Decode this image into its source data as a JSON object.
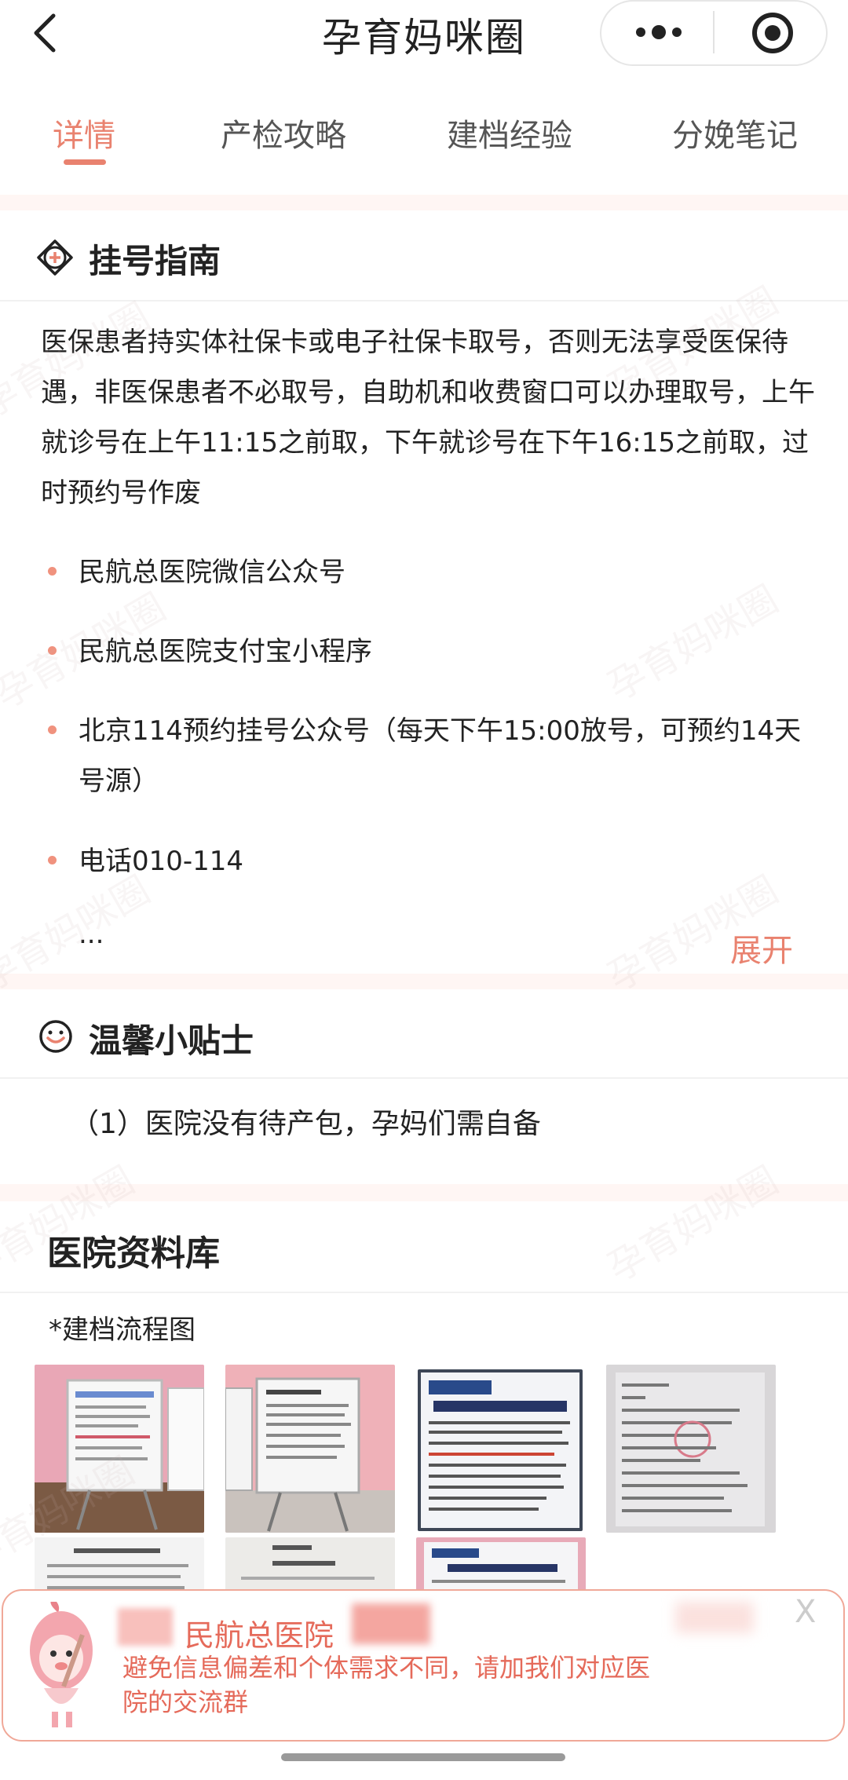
{
  "header": {
    "title": "孕育妈咪圈"
  },
  "tabs": [
    {
      "label": "详情"
    },
    {
      "label": "产检攻略"
    },
    {
      "label": "建档经验"
    },
    {
      "label": "分娩笔记"
    }
  ],
  "registration": {
    "title": "挂号指南",
    "description": "医保患者持实体社保卡或电子社保卡取号，否则无法享受医保待遇，非医保患者不必取号，自助机和收费窗口可以办理取号，上午就诊号在上午11:15之前取，下午就诊号在下午16:15之前取，过时预约号作废",
    "items": [
      {
        "text": "民航总医院微信公众号"
      },
      {
        "text": "民航总医院支付宝小程序"
      },
      {
        "text": "北京114预约挂号公众号（每天下午15:00放号，可预约14天号源）"
      },
      {
        "text": "电话010-114"
      }
    ],
    "ellipsis": "...",
    "expand_label": "展开"
  },
  "tips": {
    "title": "温馨小贴士",
    "text": "（1）医院没有待产包，孕妈们需自备"
  },
  "library": {
    "title": "医院资料库",
    "subtitle": "*建档流程图"
  },
  "banner": {
    "title": "民航总医院",
    "text": "避免信息偏差和个体需求不同，请加我们对应医院的交流群",
    "close": "X"
  },
  "watermark": "孕育妈咪圈",
  "colors": {
    "accent": "#e9826f",
    "banner_text": "#e56a5a",
    "bullet": "#f0927e",
    "band": "#fff6f4"
  }
}
